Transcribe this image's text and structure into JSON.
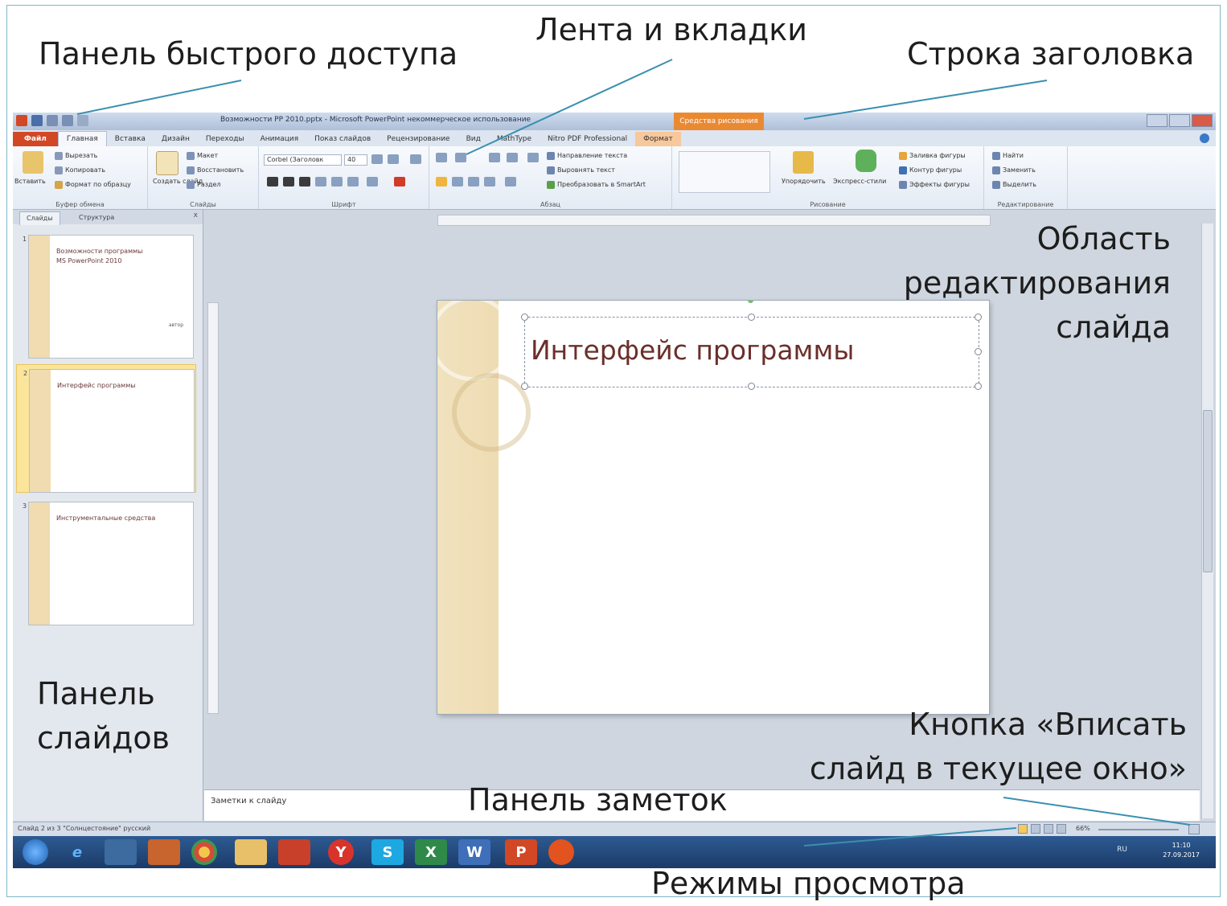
{
  "callouts": {
    "quick_access": "Панель быстрого доступа",
    "ribbon": "Лента и вкладки",
    "title_bar": "Строка заголовка",
    "edit_area_1": "Область",
    "edit_area_2": "редактирования",
    "edit_area_3": "слайда",
    "slides_panel_1": "Панель",
    "slides_panel_2": "слайдов",
    "fit_button_1": "Кнопка «Вписать",
    "fit_button_2": "слайд в текущее окно»",
    "notes_panel": "Панель заметок",
    "view_modes": "Режимы просмотра"
  },
  "window": {
    "title": "Возможности PP 2010.pptx - Microsoft PowerPoint некоммерческое использование",
    "context_title": "Средства рисования"
  },
  "tabs": [
    "Файл",
    "Главная",
    "Вставка",
    "Дизайн",
    "Переходы",
    "Анимация",
    "Показ слайдов",
    "Рецензирование",
    "Вид",
    "MathType",
    "Nitro PDF Professional",
    "Формат"
  ],
  "ribbon": {
    "clipboard": {
      "label": "Буфер обмена",
      "paste": "Вставить",
      "cut": "Вырезать",
      "copy": "Копировать",
      "format": "Формат по образцу"
    },
    "slides": {
      "label": "Слайды",
      "new": "Создать слайд",
      "layout": "Макет",
      "reset": "Восстановить",
      "section": "Раздел"
    },
    "font": {
      "label": "Шрифт",
      "name": "Corbel (Заголовк",
      "size": "40"
    },
    "paragraph": {
      "label": "Абзац",
      "dir": "Направление текста",
      "align": "Выровнять текст",
      "smartart": "Преобразовать в SmartArt"
    },
    "drawing": {
      "label": "Рисование",
      "arrange": "Упорядочить",
      "styles": "Экспресс-стили",
      "fill": "Заливка фигуры",
      "outline": "Контур фигуры",
      "effects": "Эффекты фигуры"
    },
    "editing": {
      "label": "Редактирование",
      "find": "Найти",
      "replace": "Заменить",
      "select": "Выделить"
    }
  },
  "slides_pane": {
    "tab_slides": "Слайды",
    "tab_outline": "Структура",
    "close": "x",
    "thumbs": [
      {
        "num": "1",
        "title": "Возможности программы\nMS PowerPoint 2010",
        "subtitle": "автор"
      },
      {
        "num": "2",
        "title": "Интерфейс программы",
        "subtitle": ""
      },
      {
        "num": "3",
        "title": "Инструментальные средства",
        "subtitle": ""
      }
    ]
  },
  "slide": {
    "title": "Интерфейс программы"
  },
  "notes": {
    "placeholder": "Заметки к слайду"
  },
  "status": {
    "text": "Слайд 2 из 3   \"Солнцестояние\"   русский",
    "zoom": "66%"
  },
  "taskbar": {
    "lang": "RU",
    "time": "11:10",
    "date": "27.09.2017"
  },
  "colors": {
    "file_tab": "#d24726",
    "context_tab": "#e98a33",
    "slide_title": "#6b2f2a",
    "slide_band": "#f0dcb0"
  }
}
